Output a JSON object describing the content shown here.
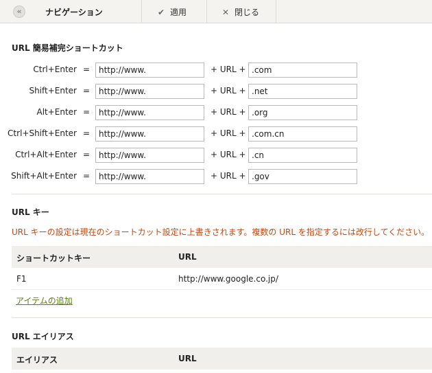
{
  "toolbar": {
    "back_glyph": "«",
    "title": "ナビゲーション",
    "apply_icon": "✔",
    "apply_label": "適用",
    "close_icon": "✕",
    "close_label": "閉じる"
  },
  "shortcuts": {
    "title": "URL 簡易補完ショートカット",
    "equals": "=",
    "plus_label": "+ URL +",
    "rows": [
      {
        "combo": "Ctrl+Enter",
        "prefix": "http://www.",
        "suffix": ".com"
      },
      {
        "combo": "Shift+Enter",
        "prefix": "http://www.",
        "suffix": ".net"
      },
      {
        "combo": "Alt+Enter",
        "prefix": "http://www.",
        "suffix": ".org"
      },
      {
        "combo": "Ctrl+Shift+Enter",
        "prefix": "http://www.",
        "suffix": ".com.cn"
      },
      {
        "combo": "Ctrl+Alt+Enter",
        "prefix": "http://www.",
        "suffix": ".cn"
      },
      {
        "combo": "Shift+Alt+Enter",
        "prefix": "http://www.",
        "suffix": ".gov"
      }
    ]
  },
  "url_keys": {
    "title": "URL キー",
    "notice": "URL キーの設定は現在のショートカット設定に上書きされます。複数の URL を指定するには改行してください。",
    "col_shortcut": "ショートカットキー",
    "col_url": "URL",
    "rows": [
      {
        "key": "F1",
        "url": "http://www.google.co.jp/"
      }
    ],
    "add_label": "アイテムの追加"
  },
  "aliases": {
    "title": "URL エイリアス",
    "col_alias": "エイリアス",
    "col_url": "URL"
  }
}
